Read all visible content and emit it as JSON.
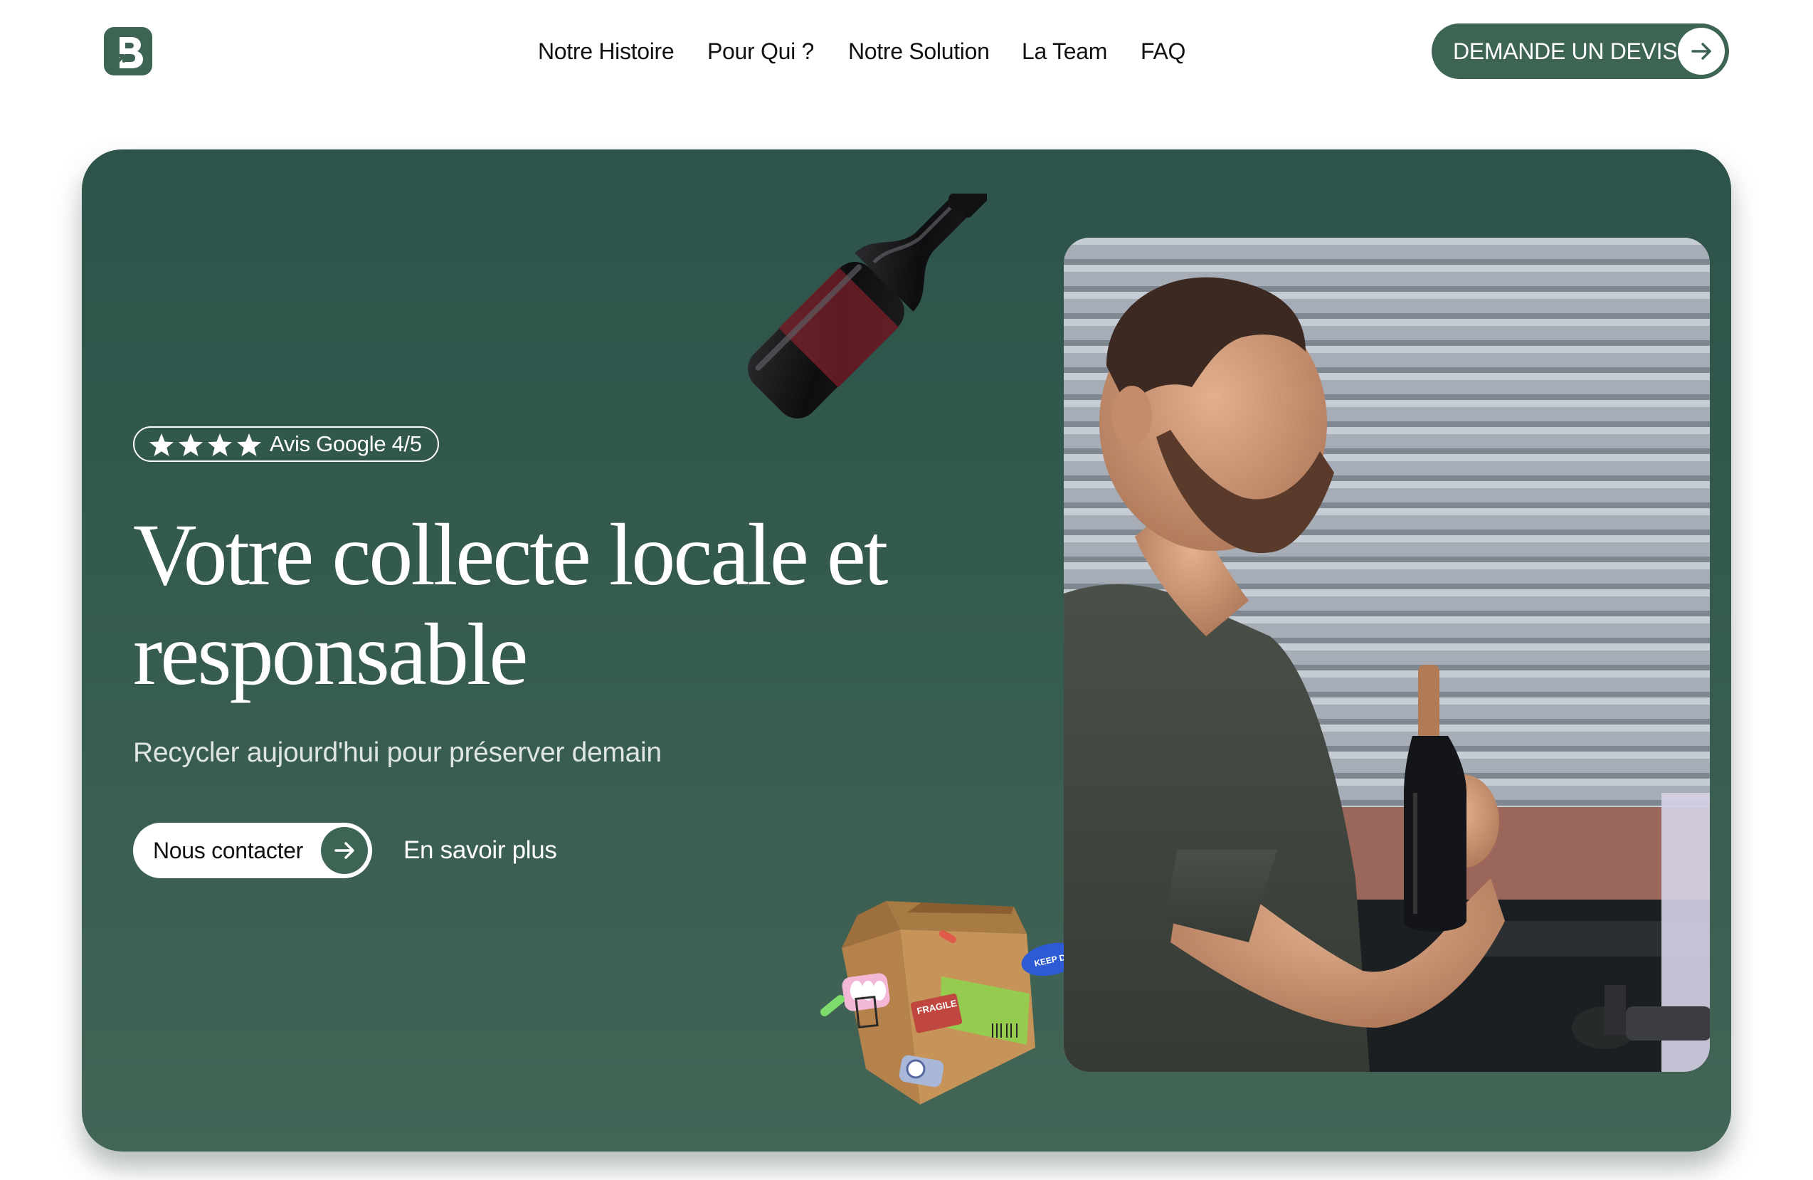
{
  "nav": {
    "links": [
      "Notre Histoire",
      "Pour Qui ?",
      "Notre Solution",
      "La Team",
      "FAQ"
    ],
    "cta_label": "DEMANDE UN DEVIS"
  },
  "hero": {
    "rating_badge": "Avis Google 4/5",
    "rating_stars": 4,
    "headline": "Votre collecte locale et responsable",
    "subline": "Recycler aujourd'hui pour préserver demain",
    "primary_button": "Nous contacter",
    "secondary_link": "En savoir plus"
  },
  "box_stickers": [
    "FRAGILE",
    "KEEP DRY"
  ],
  "icons": {
    "logo": "brand-b-logo",
    "arrow": "arrow-right-icon",
    "star": "star-icon"
  },
  "colors": {
    "brand_green": "#3e6454",
    "hero_top": "#2d534b",
    "hero_bottom": "#436556",
    "white": "#ffffff"
  }
}
